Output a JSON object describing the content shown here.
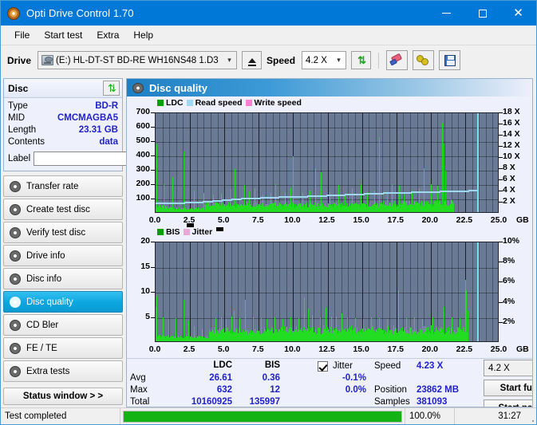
{
  "window": {
    "title": "Opti Drive Control 1.70",
    "app_icon": "disc-icon",
    "minimize": "minimize-icon",
    "maximize": "maximize-icon",
    "close": "close-icon"
  },
  "menu": {
    "items": [
      "File",
      "Start test",
      "Extra",
      "Help"
    ]
  },
  "toolbar": {
    "drive_label": "Drive",
    "drive_value": "(E:)  HL-DT-ST BD-RE  WH16NS48 1.D3",
    "eject_label": "eject-icon",
    "speed_label": "Speed",
    "speed_value": "4.2 X",
    "refresh_icon": "refresh-icon",
    "erase_icon": "erase-icon",
    "tools_icon": "tools-icon",
    "save_icon": "save-icon"
  },
  "disc_panel": {
    "title": "Disc",
    "refresh_icon": "refresh-icon",
    "rows": [
      {
        "key": "Type",
        "value": "BD-R"
      },
      {
        "key": "MID",
        "value": "CMCMAGBA5"
      },
      {
        "key": "Length",
        "value": "23.31 GB"
      },
      {
        "key": "Contents",
        "value": "data"
      }
    ],
    "label_key": "Label",
    "label_value": "",
    "label_placeholder": "",
    "label_button_icon": "disc-icon"
  },
  "nav": {
    "items": [
      {
        "label": "Transfer rate",
        "active": false
      },
      {
        "label": "Create test disc",
        "active": false
      },
      {
        "label": "Verify test disc",
        "active": false
      },
      {
        "label": "Drive info",
        "active": false
      },
      {
        "label": "Disc info",
        "active": false
      },
      {
        "label": "Disc quality",
        "active": true
      },
      {
        "label": "CD Bler",
        "active": false
      },
      {
        "label": "FE / TE",
        "active": false
      },
      {
        "label": "Extra tests",
        "active": false
      }
    ],
    "status_window": "Status window > >"
  },
  "panel": {
    "title": "Disc quality",
    "icon": "disc-quality-icon"
  },
  "chart_data": [
    {
      "type": "area",
      "name": "quality-chart",
      "title": "LDC / Read speed",
      "xlabel": "GB",
      "ylabel": "",
      "xlim": [
        0.0,
        25.0
      ],
      "ylim": [
        0,
        700
      ],
      "y2lim": [
        0,
        18
      ],
      "y2label": "X",
      "xticks": [
        "0.0",
        "2.5",
        "5.0",
        "7.5",
        "10.0",
        "12.5",
        "15.0",
        "17.5",
        "20.0",
        "22.5",
        "25.0"
      ],
      "yticks": [
        100,
        200,
        300,
        400,
        500,
        600,
        700
      ],
      "y2ticks": [
        "2 X",
        "4 X",
        "6 X",
        "8 X",
        "10 X",
        "12 X",
        "14 X",
        "16 X",
        "18 X"
      ],
      "grid": true,
      "legend": [
        {
          "label": "LDC",
          "color": "#00a000"
        },
        {
          "label": "Read speed",
          "color": "#9fd8f2"
        },
        {
          "label": "Write speed",
          "color": "#ff80d0"
        }
      ],
      "data_end_gb": 23.4,
      "series": [
        {
          "name": "LDC",
          "color": "#22dd22",
          "baseline": [
            62,
            55,
            52,
            50,
            48,
            46,
            44,
            42,
            40,
            38,
            36,
            34,
            32,
            30,
            30,
            30,
            30,
            30,
            30,
            30,
            30,
            30,
            30,
            30,
            30,
            30,
            30,
            30,
            30,
            30,
            30,
            30,
            30,
            30,
            30,
            30,
            30,
            30,
            30,
            30,
            62,
            66,
            70,
            68,
            66,
            64,
            66,
            68,
            66,
            64,
            62,
            64,
            66,
            64,
            62,
            60,
            62,
            64,
            62,
            60,
            62,
            64,
            62,
            60,
            62,
            64,
            62,
            60,
            62,
            64,
            62,
            60,
            62,
            64,
            62,
            60,
            62,
            64,
            62,
            60,
            62,
            64,
            62,
            60,
            62,
            64,
            62,
            60,
            62,
            64,
            62,
            60,
            62,
            64,
            62,
            60,
            62,
            64,
            62,
            60,
            62,
            64,
            62,
            60,
            62,
            64,
            62,
            60,
            62,
            64,
            62,
            60,
            62,
            64,
            62,
            60,
            62,
            64,
            62,
            60,
            62,
            64,
            62,
            60,
            62,
            64,
            62,
            60,
            62,
            64,
            62,
            60,
            62,
            64,
            62,
            60,
            62,
            64,
            62,
            60,
            62,
            64,
            62,
            60,
            62,
            64,
            62,
            60,
            62,
            64,
            62,
            60,
            62,
            64,
            62,
            60,
            62,
            64,
            62,
            60,
            62,
            64,
            62,
            60,
            62,
            64,
            62,
            60,
            62,
            64,
            62,
            60,
            62,
            64,
            62,
            60,
            62,
            64,
            62,
            60,
            66,
            70,
            68,
            66,
            70,
            68,
            66,
            70,
            68,
            66,
            70,
            68,
            66,
            70,
            68,
            66,
            70,
            68,
            66,
            70,
            72,
            74,
            72,
            70,
            72,
            74,
            72,
            70,
            72,
            74,
            72,
            70,
            74,
            78,
            74,
            70,
            74,
            78,
            74,
            70,
            78,
            82,
            78,
            74,
            78,
            82,
            78,
            74,
            80,
            84,
            80,
            76,
            80,
            84,
            80,
            76,
            84,
            88,
            84,
            80,
            84,
            0,
            0,
            0,
            0,
            0,
            0,
            0,
            0,
            0,
            0,
            0,
            0,
            0,
            0,
            0,
            0,
            0,
            0,
            0
          ],
          "spikes": [
            [
              0,
              470
            ],
            [
              6,
              195
            ],
            [
              13,
              245
            ],
            [
              22,
              425
            ],
            [
              30,
              150
            ],
            [
              38,
              135
            ],
            [
              46,
              120
            ],
            [
              52,
              130
            ],
            [
              60,
              160
            ],
            [
              63,
              300
            ],
            [
              71,
              190
            ],
            [
              75,
              145
            ],
            [
              79,
              165
            ],
            [
              86,
              120
            ],
            [
              92,
              135
            ],
            [
              96,
              195
            ],
            [
              104,
              140
            ],
            [
              108,
              165
            ],
            [
              110,
              390
            ],
            [
              118,
              135
            ],
            [
              124,
              150
            ],
            [
              128,
              305
            ],
            [
              133,
              278
            ],
            [
              140,
              140
            ],
            [
              147,
              190
            ],
            [
              152,
              120
            ],
            [
              158,
              165
            ],
            [
              165,
              195
            ],
            [
              170,
              140
            ],
            [
              176,
              150
            ],
            [
              180,
              525
            ],
            [
              186,
              140
            ],
            [
              190,
              195
            ],
            [
              196,
              185
            ],
            [
              200,
              140
            ],
            [
              206,
              150
            ],
            [
              212,
              165
            ],
            [
              216,
              305
            ],
            [
              222,
              195
            ],
            [
              227,
              185
            ],
            [
              231,
              625
            ],
            [
              232,
              480
            ],
            [
              233,
              290
            ]
          ]
        },
        {
          "name": "Read speed",
          "color": "#9fd8f2",
          "unit": "X",
          "start": 1.95,
          "end": 4.23,
          "values_x": [
            1.95,
            2.0,
            2.05,
            2.1,
            2.2,
            2.3,
            2.45,
            2.6,
            2.7,
            2.8,
            2.9,
            3.0,
            3.05,
            3.1,
            3.15,
            3.2,
            3.3,
            3.35,
            3.4,
            3.5,
            3.55,
            3.6,
            3.65,
            3.7,
            3.8,
            3.85,
            3.9,
            3.95,
            4.0,
            4.05,
            4.1,
            4.15,
            4.2,
            4.23
          ]
        }
      ]
    },
    {
      "type": "area",
      "name": "bis-chart",
      "title": "BIS / Jitter",
      "xlabel": "GB",
      "ylabel": "",
      "xlim": [
        0.0,
        25.0
      ],
      "ylim": [
        0,
        20
      ],
      "y2lim": [
        0,
        10
      ],
      "y2label": "%",
      "xticks": [
        "0.0",
        "2.5",
        "5.0",
        "7.5",
        "10.0",
        "12.5",
        "15.0",
        "17.5",
        "20.0",
        "22.5",
        "25.0"
      ],
      "yticks": [
        5,
        10,
        15,
        20
      ],
      "y2ticks": [
        "2%",
        "4%",
        "6%",
        "8%",
        "10%"
      ],
      "grid": true,
      "legend": [
        {
          "label": "BIS",
          "color": "#00a000"
        },
        {
          "label": "Jitter",
          "color": "#e8a8d8"
        }
      ],
      "data_end_gb": 23.4,
      "series": [
        {
          "name": "BIS",
          "color": "#22dd22",
          "baseline": [
            9.0,
            1.6,
            1.4,
            1.3,
            1.2,
            1.2,
            1.1,
            1.1,
            1.0,
            1.0,
            1.0,
            1.0,
            1.0,
            1.0,
            1.0,
            1.0,
            1.0,
            1.0,
            1.0,
            1.0,
            1.0,
            1.0,
            1.0,
            1.0,
            1.0,
            1.0,
            1.0,
            1.0,
            1.0,
            1.0,
            1.0,
            1.0,
            1.0,
            1.0,
            1.0,
            1.0,
            1.0,
            1.0,
            1.0,
            1.0,
            2.4,
            2.6,
            2.5,
            2.4,
            2.6,
            2.5,
            2.4,
            2.6,
            2.5,
            2.4,
            2.6,
            2.5,
            2.4,
            2.6,
            2.5,
            2.4,
            2.6,
            2.5,
            2.4,
            2.6,
            2.5,
            2.4,
            2.6,
            2.5,
            2.4,
            2.6,
            2.5,
            2.4,
            2.6,
            2.5,
            2.4,
            2.6,
            2.5,
            2.4,
            2.6,
            2.5,
            2.4,
            2.6,
            2.5,
            2.4,
            2.6,
            2.8,
            2.6,
            2.5,
            2.7,
            2.9,
            2.6,
            2.5,
            2.7,
            2.9,
            2.6,
            2.5,
            2.7,
            2.9,
            2.6,
            2.5,
            2.7,
            2.9,
            2.6,
            2.5,
            2.7,
            2.9,
            2.6,
            2.5,
            2.7,
            2.9,
            2.6,
            2.5,
            2.7,
            2.9,
            2.6,
            2.5,
            2.7,
            2.9,
            2.6,
            2.5,
            2.7,
            2.9,
            2.6,
            2.5,
            2.7,
            2.9,
            2.6,
            2.5,
            2.7,
            2.9,
            2.6,
            2.5,
            2.7,
            2.9,
            2.6,
            2.5,
            2.7,
            2.9,
            2.6,
            2.5,
            2.7,
            2.9,
            2.6,
            2.5,
            2.7,
            2.9,
            2.6,
            2.5,
            2.7,
            2.9,
            2.6,
            2.5,
            2.7,
            2.9,
            2.6,
            2.5,
            2.7,
            2.9,
            2.6,
            2.5,
            2.7,
            2.9,
            2.6,
            2.5,
            2.7,
            2.9,
            2.6,
            2.5,
            2.7,
            2.9,
            2.6,
            2.5,
            2.7,
            2.9,
            2.6,
            2.5,
            2.7,
            2.9,
            2.6,
            2.5,
            2.7,
            2.9,
            2.6,
            2.5,
            2.7,
            2.9,
            2.6,
            2.5,
            2.7,
            2.9,
            2.6,
            2.5,
            2.7,
            2.9,
            2.6,
            2.5,
            2.7,
            2.9,
            2.6,
            2.5,
            2.7,
            2.9,
            2.6,
            2.5,
            2.8,
            3.0,
            2.7,
            2.6,
            2.8,
            3.0,
            2.7,
            2.6,
            2.8,
            3.0,
            2.7,
            2.6,
            2.8,
            3.0,
            2.7,
            2.6,
            2.8,
            3.0,
            2.7,
            2.6,
            2.8,
            3.0,
            2.7,
            2.6,
            2.8,
            3.0,
            2.7,
            2.6,
            2.8,
            3.0,
            2.7,
            2.6,
            3.0,
            0,
            0,
            0,
            0,
            0,
            0,
            0
          ],
          "spikes": [
            [
              0,
              9.0
            ],
            [
              5,
              4.8
            ],
            [
              9,
              4.4
            ],
            [
              14,
              4.6
            ],
            [
              20,
              8.2
            ],
            [
              24,
              4.2
            ],
            [
              28,
              3.0
            ],
            [
              34,
              2.4
            ],
            [
              44,
              4.6
            ],
            [
              48,
              4.8
            ],
            [
              52,
              4.4
            ],
            [
              56,
              4.9
            ],
            [
              58,
              6.0
            ],
            [
              62,
              4.6
            ],
            [
              66,
              8.2
            ],
            [
              72,
              4.9
            ],
            [
              78,
              4.6
            ],
            [
              82,
              4.4
            ],
            [
              88,
              4.7
            ],
            [
              94,
              4.5
            ],
            [
              100,
              4.8
            ],
            [
              106,
              4.6
            ],
            [
              110,
              8.8
            ],
            [
              113,
              6.5
            ],
            [
              116,
              5.2
            ],
            [
              122,
              4.7
            ],
            [
              126,
              6.7
            ],
            [
              130,
              4.9
            ],
            [
              134,
              5.0
            ],
            [
              138,
              5.6
            ],
            [
              142,
              4.8
            ],
            [
              148,
              4.6
            ],
            [
              154,
              4.5
            ],
            [
              160,
              4.7
            ],
            [
              166,
              4.6
            ],
            [
              172,
              4.5
            ],
            [
              180,
              10.1
            ],
            [
              186,
              4.6
            ],
            [
              192,
              4.8
            ],
            [
              198,
              4.5
            ],
            [
              206,
              4.7
            ],
            [
              214,
              6.9
            ],
            [
              220,
              4.8
            ],
            [
              226,
              4.6
            ],
            [
              230,
              12.2
            ],
            [
              231,
              10.2
            ],
            [
              232,
              6.0
            ]
          ]
        }
      ]
    }
  ],
  "stats": {
    "col_ldc": "LDC",
    "col_bis": "BIS",
    "row_avg": "Avg",
    "row_max": "Max",
    "row_total": "Total",
    "ldc_avg": "26.61",
    "ldc_max": "632",
    "ldc_total": "10160925",
    "bis_avg": "0.36",
    "bis_max": "12",
    "bis_total": "135997",
    "jitter_label": "Jitter",
    "jitter_checked": true,
    "jitter_avg": "-0.1%",
    "jitter_max": "0.0%",
    "speed_label": "Speed",
    "speed_value": "4.23 X",
    "position_label": "Position",
    "position_value": "23862 MB",
    "samples_label": "Samples",
    "samples_value": "381093",
    "speed_select": "4.2 X",
    "start_full": "Start full",
    "start_part": "Start part"
  },
  "statusbar": {
    "message": "Test completed",
    "progress_percent": "100.0%",
    "progress_value": 100,
    "elapsed": "31:27"
  }
}
